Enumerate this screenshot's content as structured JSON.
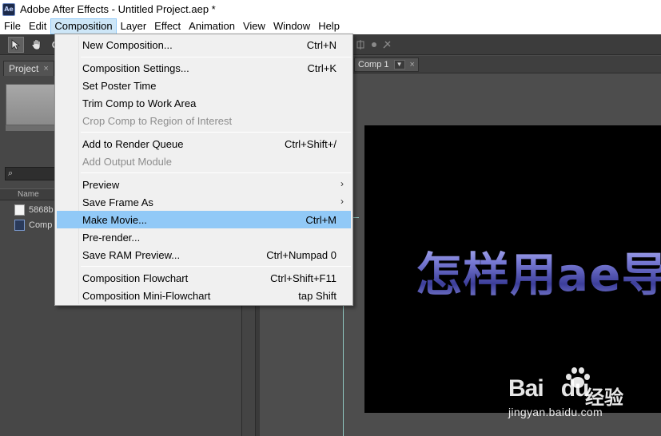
{
  "window": {
    "app_icon": "Ae",
    "title": "Adobe After Effects - Untitled Project.aep *"
  },
  "menubar": {
    "items": [
      "File",
      "Edit",
      "Composition",
      "Layer",
      "Effect",
      "Animation",
      "View",
      "Window",
      "Help"
    ],
    "active": "Composition"
  },
  "project_panel": {
    "tab_label": "Project",
    "close_glyph": "×",
    "search_glyph": "⌕",
    "column_name": "Name",
    "rows": [
      {
        "label": "5868b",
        "type": "file"
      },
      {
        "label": "Comp",
        "type": "composition"
      }
    ]
  },
  "comp_panel": {
    "tab_label": "Comp 1",
    "close_glyph": "×",
    "canvas_text": "怎样用ae导"
  },
  "composition_menu": {
    "items": [
      {
        "label": "New Composition...",
        "shortcut": "Ctrl+N",
        "disabled": false
      },
      {
        "label": "Composition Settings...",
        "shortcut": "Ctrl+K",
        "disabled": false
      },
      {
        "label": "Set Poster Time",
        "shortcut": "",
        "disabled": false
      },
      {
        "label": "Trim Comp to Work Area",
        "shortcut": "",
        "disabled": false
      },
      {
        "label": "Crop Comp to Region of Interest",
        "shortcut": "",
        "disabled": true
      },
      {
        "label": "Add to Render Queue",
        "shortcut": "Ctrl+Shift+/",
        "disabled": false
      },
      {
        "label": "Add Output Module",
        "shortcut": "",
        "disabled": true
      },
      {
        "label": "Preview",
        "shortcut": "",
        "disabled": false,
        "submenu": true
      },
      {
        "label": "Save Frame As",
        "shortcut": "",
        "disabled": false,
        "submenu": true
      },
      {
        "label": "Make Movie...",
        "shortcut": "Ctrl+M",
        "disabled": false,
        "highlighted": true
      },
      {
        "label": "Pre-render...",
        "shortcut": "",
        "disabled": false
      },
      {
        "label": "Save RAM Preview...",
        "shortcut": "Ctrl+Numpad 0",
        "disabled": false
      },
      {
        "label": "Composition Flowchart",
        "shortcut": "Ctrl+Shift+F11",
        "disabled": false
      },
      {
        "label": "Composition Mini-Flowchart",
        "shortcut": "tap Shift",
        "disabled": false
      }
    ],
    "submenu_arrow": "›"
  },
  "watermark": {
    "brand": "Bai",
    "brand_suffix": "du",
    "cn_text": "经验",
    "url": "jingyan.baidu.com"
  },
  "colors": {
    "menu_highlight": "#91c9f7",
    "active_menu_bg": "#cde6f7",
    "panel_bg": "#474747",
    "canvas_bg": "#000000"
  }
}
